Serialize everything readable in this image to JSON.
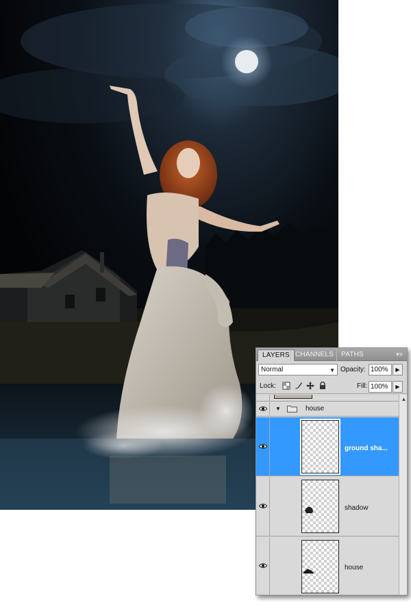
{
  "panel": {
    "tabs": [
      {
        "label": "LAYERS",
        "active": true
      },
      {
        "label": "CHANNELS",
        "active": false
      },
      {
        "label": "PATHS",
        "active": false
      }
    ],
    "menu_icon": "panel-menu-icon",
    "blend_mode": "Normal",
    "opacity_label": "Opacity:",
    "opacity_value": "100%",
    "lock_label": "Lock:",
    "lock_icons": [
      "lock-transparent-icon",
      "lock-image-icon",
      "lock-position-icon",
      "lock-all-icon"
    ],
    "fill_label": "Fill:",
    "fill_value": "100%",
    "group": {
      "name": "house",
      "expanded": true
    },
    "layers": [
      {
        "name": "ground sha...",
        "visible": true,
        "selected": true
      },
      {
        "name": "shadow",
        "visible": true,
        "selected": false
      },
      {
        "name": "house",
        "visible": true,
        "selected": false
      }
    ]
  },
  "colors": {
    "selection": "#3399ff",
    "panel_bg": "#d6d6d6",
    "tab_bar": "#8e8e8e"
  }
}
